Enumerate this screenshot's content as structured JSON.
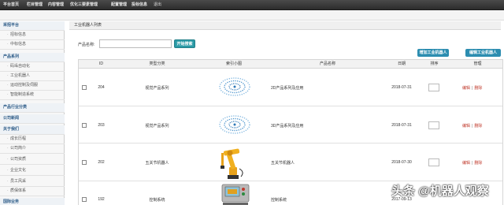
{
  "topnav": {
    "items": [
      "平台首页",
      "栏目管理",
      "内容管理",
      "优化三要素管理",
      "配置管理",
      "投标信息",
      "退出"
    ]
  },
  "sidebar": {
    "rows": [
      {
        "type": "section",
        "label": "采招平台"
      },
      {
        "type": "item",
        "label": "招标信息"
      },
      {
        "type": "item",
        "label": "中标信息"
      },
      {
        "type": "section",
        "label": "产品系列"
      },
      {
        "type": "item",
        "label": "码垛自动化"
      },
      {
        "type": "item",
        "label": "工业机器人"
      },
      {
        "type": "item",
        "label": "运动控制及伺服"
      },
      {
        "type": "item",
        "label": "智能制造系统"
      },
      {
        "type": "section",
        "label": "产品行业分类"
      },
      {
        "type": "section",
        "label": "公司新闻"
      },
      {
        "type": "section",
        "label": "关于我们"
      },
      {
        "type": "item",
        "label": "成长历程"
      },
      {
        "type": "item",
        "label": "公司简介"
      },
      {
        "type": "item",
        "label": "公司资质"
      },
      {
        "type": "item",
        "label": "企业文化"
      },
      {
        "type": "item",
        "label": "员工风采"
      },
      {
        "type": "item",
        "label": "质保体系"
      },
      {
        "type": "section",
        "label": "国际业务"
      }
    ]
  },
  "main": {
    "panel_title": "工业机器人列表",
    "search_label": "产品名称:",
    "search_value": "",
    "search_button": "开始搜索",
    "add_button": "增加工业机器人",
    "edit_button": "编辑工业机器人",
    "columns": [
      "",
      "ID",
      "类型分类",
      "索引小图",
      "产品名称",
      "日期",
      "排序",
      "管理"
    ],
    "rows": [
      {
        "id": "204",
        "category": "视觉产品系列",
        "thumb": "vision-dots",
        "name": "2D产品系列及应用",
        "date": "2018-07-31",
        "op_edit": "编辑",
        "op_sep": "|",
        "op_delete": "删除"
      },
      {
        "id": "203",
        "category": "视觉产品系列",
        "thumb": "vision-dots",
        "name": "3D产品系列及应用",
        "date": "2018-07-31",
        "op_edit": "编辑",
        "op_sep": "|",
        "op_delete": "删除"
      },
      {
        "id": "202",
        "category": "五关节机器人",
        "thumb": "robot-arm",
        "name": "五关节机器人",
        "date": "2018-07-30",
        "op_edit": "编辑",
        "op_sep": "|",
        "op_delete": "删除"
      },
      {
        "id": "192",
        "category": "控制系统",
        "thumb": "control-panel",
        "name": "控制系统",
        "date": "2017-09-13",
        "op_edit": "",
        "op_sep": "",
        "op_delete": ""
      }
    ]
  },
  "watermark": "头条 @机器人观察",
  "colors": {
    "nav_bg": "#333333",
    "button_teal": "#2a9aa6",
    "button_blue": "#2c8db0",
    "op_red": "#c0392b",
    "section_blue": "#2b5a87"
  }
}
